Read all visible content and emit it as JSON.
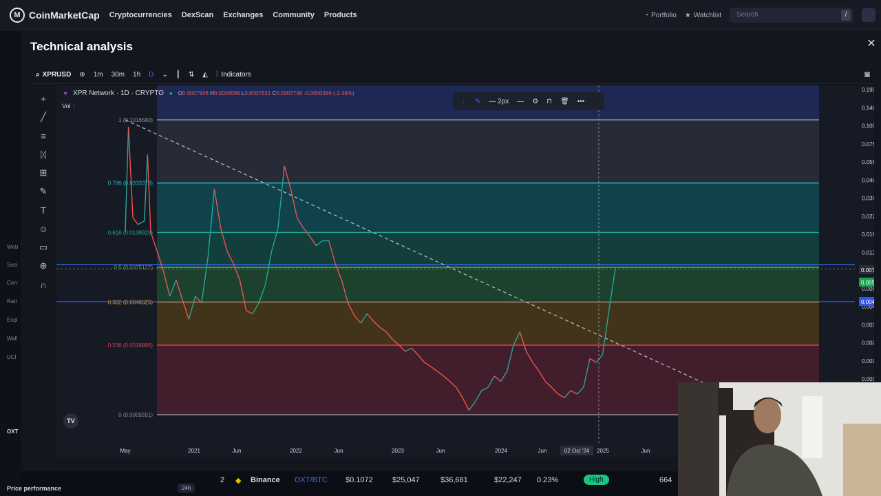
{
  "nav": {
    "brand": "CoinMarketCap",
    "links": [
      "Cryptocurrencies",
      "DexScan",
      "Exchanges",
      "Community",
      "Products"
    ],
    "portfolio": "Portfolio",
    "watchlist": "Watchlist",
    "search_placeholder": "Search",
    "search_shortcut": "/"
  },
  "bg_sidebar": [
    "Web",
    "Soci",
    "Con",
    "Rati",
    "Expl",
    "Wall",
    "UCI",
    "OXT"
  ],
  "modal": {
    "title": "Technical analysis",
    "close": "✕"
  },
  "toolbar": {
    "symbol": "XPRUSD",
    "timeframes": [
      "1m",
      "30m",
      "1h",
      "D"
    ],
    "active_timeframe": "D",
    "indicators": "Indicators"
  },
  "chart_legend": {
    "name": "XPR Network · 1D · CRYPTO",
    "o_label": "O",
    "o": "0.0007946",
    "h_label": "H",
    "h": "0.0008099",
    "l_label": "L",
    "l": "0.0007631",
    "c_label": "C",
    "c": "0.0007748",
    "change": "-0.0000396 (-2.49%)",
    "vol": "Vol"
  },
  "float_toolbar": {
    "width_label": "2px"
  },
  "chart_data": {
    "type": "line",
    "title": "XPR Network · 1D · CRYPTO",
    "y_scale": "log",
    "y_ticks": [
      "0.1900000",
      "0.1400000",
      "0.1000000",
      "0.0750000",
      "0.0550000",
      "0.0400000",
      "0.0300000",
      "0.0220000",
      "0.0160000",
      "0.0120000",
      "0.0090000",
      "0.0058211",
      "0.0045000",
      "0.0033000",
      "0.0025000",
      "0.0018000",
      "0.0013000"
    ],
    "x_ticks": [
      "May",
      "2021",
      "Jun",
      "2022",
      "Jun",
      "2023",
      "Jun",
      "2024",
      "Jun",
      "02 Oct '24",
      "2025",
      "Jun"
    ],
    "price_labels": [
      {
        "value": "0.0073080",
        "color": "#2a2e39"
      },
      {
        "value": "0.0058211",
        "color": "#16a34a"
      },
      {
        "value": "0.0040921",
        "color": "#2f54eb"
      }
    ],
    "fib_levels": [
      {
        "label": "1 (0.1016580)",
        "ratio": 1,
        "color": "#8a8f9c"
      },
      {
        "label": "0.786 (0.0333370)",
        "ratio": 0.786,
        "color": "#22b8c7"
      },
      {
        "label": "0.618 (0.0138929)",
        "ratio": 0.618,
        "color": "#21a489"
      },
      {
        "label": "0.5 (0.0075127)",
        "ratio": 0.5,
        "color": "#4caf50"
      },
      {
        "label": "0.382 (0.0040625)",
        "ratio": 0.382,
        "color": "#e8a736"
      },
      {
        "label": "0.236 (0.0018986)",
        "ratio": 0.236,
        "color": "#e53950"
      },
      {
        "label": "0 (0.0005551)",
        "ratio": 0,
        "color": "#8a8f9c"
      }
    ],
    "price_series": [
      [
        0,
        0.014
      ],
      [
        0.5,
        0.09
      ],
      [
        1.2,
        0.018
      ],
      [
        2,
        0.016
      ],
      [
        3,
        0.017
      ],
      [
        3.5,
        0.055
      ],
      [
        4,
        0.014
      ],
      [
        5,
        0.01
      ],
      [
        6,
        0.007
      ],
      [
        7,
        0.0045
      ],
      [
        8,
        0.006
      ],
      [
        9,
        0.0042
      ],
      [
        10,
        0.003
      ],
      [
        11,
        0.0045
      ],
      [
        12,
        0.004
      ],
      [
        13,
        0.009
      ],
      [
        14,
        0.03
      ],
      [
        15,
        0.015
      ],
      [
        16,
        0.01
      ],
      [
        17,
        0.008
      ],
      [
        18,
        0.006
      ],
      [
        19,
        0.0035
      ],
      [
        20,
        0.0033
      ],
      [
        21,
        0.004
      ],
      [
        22,
        0.0055
      ],
      [
        23,
        0.01
      ],
      [
        24,
        0.015
      ],
      [
        25,
        0.045
      ],
      [
        26,
        0.03
      ],
      [
        27,
        0.018
      ],
      [
        28,
        0.015
      ],
      [
        29,
        0.013
      ],
      [
        30,
        0.011
      ],
      [
        31,
        0.012
      ],
      [
        32,
        0.012
      ],
      [
        33,
        0.008
      ],
      [
        34,
        0.006
      ],
      [
        35,
        0.004
      ],
      [
        36,
        0.0032
      ],
      [
        37,
        0.0028
      ],
      [
        38,
        0.0033
      ],
      [
        39,
        0.0029
      ],
      [
        40,
        0.0026
      ],
      [
        41,
        0.0024
      ],
      [
        42,
        0.0021
      ],
      [
        43,
        0.0019
      ],
      [
        44,
        0.0017
      ],
      [
        45,
        0.0018
      ],
      [
        46,
        0.0016
      ],
      [
        47,
        0.0014
      ],
      [
        48,
        0.0013
      ],
      [
        49,
        0.0012
      ],
      [
        50,
        0.0011
      ],
      [
        51,
        0.001
      ],
      [
        52,
        0.0009
      ],
      [
        53,
        0.00075
      ],
      [
        54,
        0.0006
      ],
      [
        55,
        0.0007
      ],
      [
        56,
        0.00085
      ],
      [
        57,
        0.0009
      ],
      [
        58,
        0.0011
      ],
      [
        59,
        0.001
      ],
      [
        60,
        0.0012
      ],
      [
        61,
        0.0019
      ],
      [
        62,
        0.0024
      ],
      [
        63,
        0.0017
      ],
      [
        64,
        0.0014
      ],
      [
        65,
        0.0012
      ],
      [
        66,
        0.001
      ],
      [
        67,
        0.0009
      ],
      [
        68,
        0.0008
      ],
      [
        69,
        0.00075
      ],
      [
        70,
        0.00085
      ],
      [
        71,
        0.0008
      ],
      [
        72,
        0.0009
      ],
      [
        73,
        0.0015
      ],
      [
        74,
        0.0014
      ],
      [
        75,
        0.0016
      ],
      [
        76,
        0.0035
      ],
      [
        77,
        0.0074
      ]
    ],
    "trendline": [
      [
        0,
        0.101658
      ],
      [
        77,
        0.0017
      ]
    ]
  },
  "exchange_row": {
    "rank": "2",
    "exchange": "Binance",
    "pair": "OXT/BTC",
    "price": "$0.1072",
    "depth_plus": "$25,047",
    "depth_minus": "$36,681",
    "volume": "$22,247",
    "volume_pct": "0.23%",
    "liquidity": "High",
    "score": "664"
  },
  "price_performance": "Price performance",
  "range": "24h"
}
